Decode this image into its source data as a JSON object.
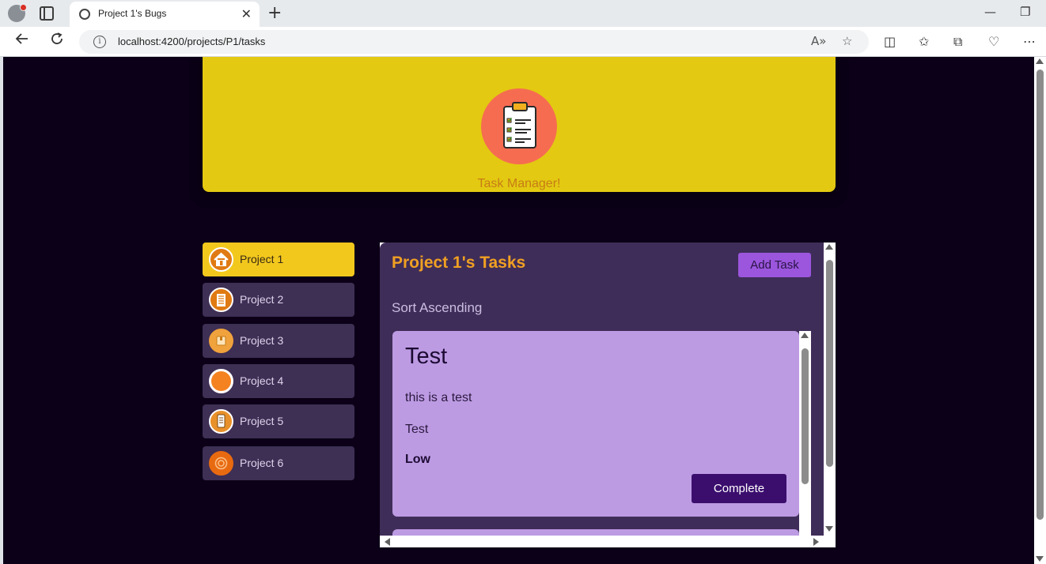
{
  "browser": {
    "tab_title": "Project 1's Bugs",
    "tab_close": "✕",
    "new_tab": "+",
    "url": "localhost:4200/projects/P1/tasks",
    "minimize": "—",
    "restore": "❐"
  },
  "hero": {
    "title": "Task Manager!",
    "logo_icon": "clipboard-checklist-icon"
  },
  "sidebar": {
    "items": [
      {
        "label": "Project 1",
        "icon": "home-icon",
        "color": "#e07a12"
      },
      {
        "label": "Project 2",
        "icon": "building-icon",
        "color": "#e07a12"
      },
      {
        "label": "Project 3",
        "icon": "box-icon",
        "color": "#f0a23c"
      },
      {
        "label": "Project 4",
        "icon": "circle-icon",
        "color": "#f58220"
      },
      {
        "label": "Project 5",
        "icon": "phone-icon",
        "color": "#e8902a"
      },
      {
        "label": "Project 6",
        "icon": "target-icon",
        "color": "#e86a10"
      }
    ]
  },
  "panel": {
    "title": "Project 1's Tasks",
    "add_task_label": "Add Task",
    "sort_label": "Sort Ascending"
  },
  "tasks": [
    {
      "title": "Test",
      "description": "this is a test",
      "tag": "Test",
      "priority": "Low",
      "action_label": "Complete"
    }
  ],
  "colors": {
    "page_bg": "#0b0017",
    "hero_bg": "#e3c911",
    "panel_bg": "#3f2d59",
    "card_bg": "#bd9be3",
    "accent_orange": "#f0a022",
    "button_purple": "#9b56dd",
    "complete_button": "#3b0e6e"
  }
}
